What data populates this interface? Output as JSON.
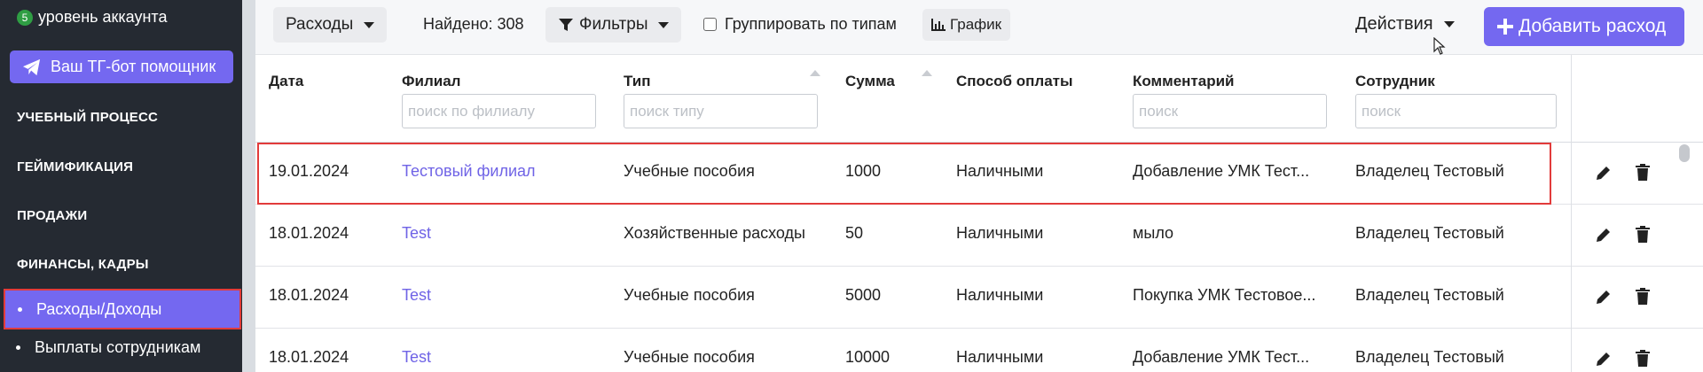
{
  "sidebar": {
    "account_level_badge": "5",
    "account_level_label": "уровень аккаунта",
    "tg_button": "Ваш ТГ-бот помощник",
    "sections": [
      "УЧЕБНЫЙ ПРОЦЕСС",
      "ГЕЙМИФИКАЦИЯ",
      "ПРОДАЖИ",
      "ФИНАНСЫ, КАДРЫ"
    ],
    "active_item": "Расходы/Доходы",
    "sub_item": "Выплаты сотрудникам"
  },
  "toolbar": {
    "type_select": "Расходы",
    "found": "Найдено: 308",
    "filters": "Фильтры",
    "group_by_type": "Группировать по типам",
    "chart": "График",
    "actions": "Действия",
    "add_expense": "Добавить расход"
  },
  "table": {
    "headers": {
      "date": "Дата",
      "branch": "Филиал",
      "type": "Тип",
      "amount": "Сумма",
      "payment": "Способ оплаты",
      "comment": "Комментарий",
      "employee": "Сотрудник"
    },
    "filters": {
      "branch_placeholder": "поиск по филиалу",
      "type_placeholder": "поиск типу",
      "comment_placeholder": "поиск",
      "employee_placeholder": "поиск"
    },
    "rows": [
      {
        "date": "19.01.2024",
        "branch": "Тестовый филиал",
        "type": "Учебные пособия",
        "amount": "1000",
        "payment": "Наличными",
        "comment": "Добавление УМК Тест...",
        "employee": "Владелец Тестовый"
      },
      {
        "date": "18.01.2024",
        "branch": "Test",
        "type": "Хозяйственные расходы",
        "amount": "50",
        "payment": "Наличными",
        "comment": "мыло",
        "employee": "Владелец Тестовый"
      },
      {
        "date": "18.01.2024",
        "branch": "Test",
        "type": "Учебные пособия",
        "amount": "5000",
        "payment": "Наличными",
        "comment": "Покупка УМК Тестовое...",
        "employee": "Владелец Тестовый"
      },
      {
        "date": "18.01.2024",
        "branch": "Test",
        "type": "Учебные пособия",
        "amount": "10000",
        "payment": "Наличными",
        "comment": "Добавление УМК Тест...",
        "employee": "Владелец Тестовый"
      }
    ]
  },
  "colors": {
    "accent": "#7468f0",
    "highlight": "#e23b3b",
    "sidebar_bg": "#252a32",
    "link": "#6f63e6"
  }
}
